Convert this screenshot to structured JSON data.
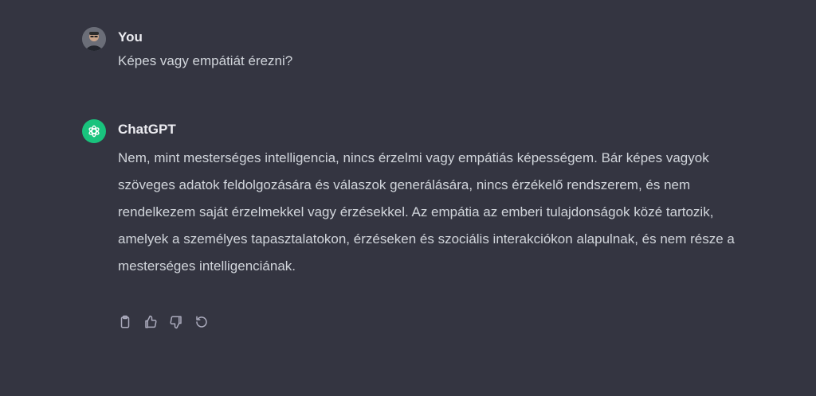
{
  "conversation": {
    "user_message": {
      "author": "You",
      "text": "Képes vagy empátiát érezni?",
      "avatar_icon": "user-photo-avatar"
    },
    "assistant_message": {
      "author": "ChatGPT",
      "avatar_icon": "openai-logo-icon",
      "avatar_color": "#19c37d",
      "text": "Nem, mint mesterséges intelligencia, nincs érzelmi vagy empátiás képességem. Bár képes vagyok szöveges adatok feldolgozására és válaszok generálására, nincs érzékelő rendszerem, és nem rendelkezem saját érzelmekkel vagy érzésekkel. Az empátia az emberi tulajdonságok közé tartozik, amelyek a személyes tapasztalatokon, érzéseken és szociális interakciókon alapulnak, és nem része a mesterséges intelligenciának.",
      "actions": [
        "copy-icon",
        "thumbs-up-icon",
        "thumbs-down-icon",
        "regenerate-icon"
      ]
    }
  },
  "theme": {
    "background": "#343541",
    "text_primary": "#ececf1",
    "text_secondary": "#d1d5db",
    "icon_color": "#acacbe"
  }
}
